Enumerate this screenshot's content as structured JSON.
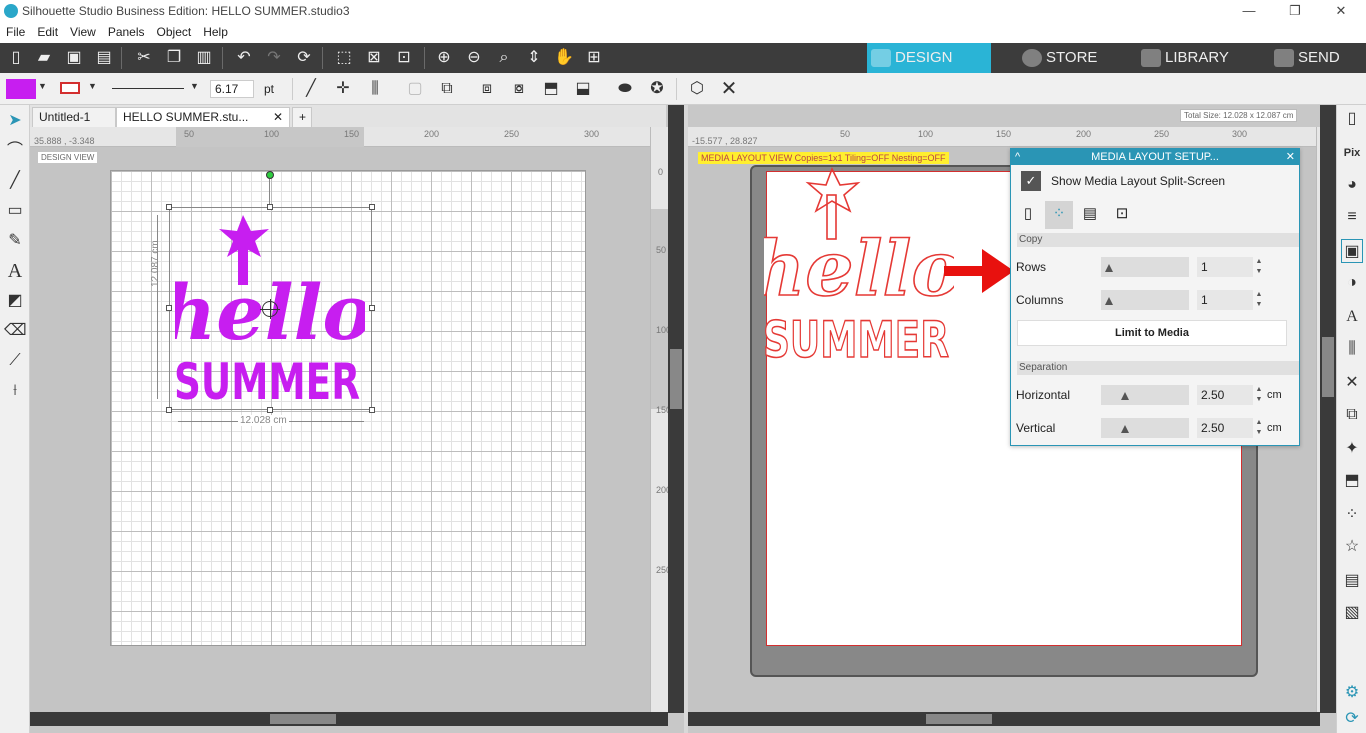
{
  "window": {
    "title": "Silhouette Studio Business Edition: HELLO SUMMER.studio3",
    "minimize": "—",
    "maximize": "❐",
    "close": "✕"
  },
  "menu": [
    "File",
    "Edit",
    "View",
    "Panels",
    "Object",
    "Help"
  ],
  "nav": {
    "design": "DESIGN",
    "store": "STORE",
    "library": "LIBRARY",
    "send": "SEND"
  },
  "properties": {
    "line_width_value": "6.17",
    "line_width_unit": "pt",
    "fill_color": "#c71ef0",
    "line_color": "#d32f2f"
  },
  "tabs": [
    {
      "label": "Untitled-1"
    },
    {
      "label": "HELLO SUMMER.stu..."
    }
  ],
  "tab_add": "+",
  "design_view": {
    "label": "DESIGN VIEW",
    "coords": "35.888 , -3.348",
    "ruler_h": [
      "50",
      "100",
      "150",
      "200",
      "250",
      "300"
    ],
    "ruler_v": [
      "0",
      "50",
      "100",
      "150",
      "200",
      "250"
    ],
    "width_dim": "12.028 cm",
    "height_dim": "12.087 cm",
    "art_color": "#c71ef0",
    "word1": "hello",
    "word2": "SUMMER"
  },
  "media_view": {
    "label": "MEDIA LAYOUT VIEW   Copies=1x1   Tiling=OFF   Nesting=OFF",
    "coords": "-15.577 , 28.827",
    "total_size": "Total Size: 12.028 x 12.087 cm",
    "ruler_h": [
      "50",
      "100",
      "150",
      "200",
      "250",
      "300"
    ],
    "ruler_v": [
      "50",
      "100",
      "150",
      "200",
      "250"
    ],
    "art_color": "#e53935",
    "word1": "hello",
    "word2": "SUMMER"
  },
  "panel": {
    "title": "MEDIA LAYOUT SETUP...",
    "split_checkbox_label": "Show Media Layout Split-Screen",
    "copy_section": "Copy",
    "rows_label": "Rows",
    "rows_value": "1",
    "columns_label": "Columns",
    "columns_value": "1",
    "limit_button": "Limit to Media",
    "separation_section": "Separation",
    "horizontal_label": "Horizontal",
    "horizontal_value": "2.50",
    "horizontal_unit": "cm",
    "vertical_label": "Vertical",
    "vertical_value": "2.50",
    "vertical_unit": "cm"
  },
  "icons": {
    "accent": "#2ab4d6",
    "dark_toolbar": "#3c3c3c"
  }
}
